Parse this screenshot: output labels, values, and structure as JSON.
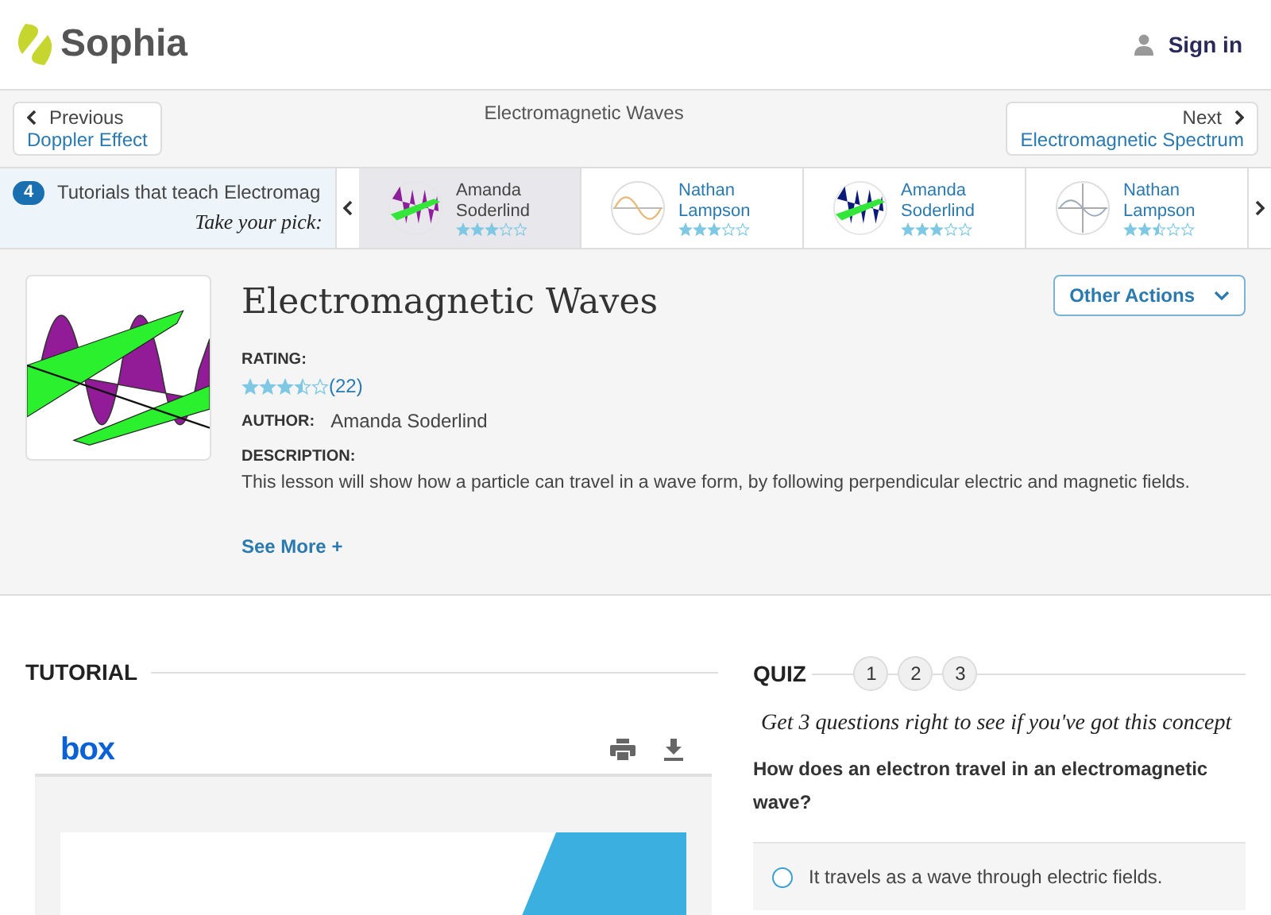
{
  "header": {
    "logo": "Sophia",
    "sign_in": "Sign in"
  },
  "nav": {
    "previous": {
      "label": "Previous",
      "title": "Doppler Effect"
    },
    "current": "Electromagnetic Waves",
    "next": {
      "label": "Next",
      "title": "Electromagnetic Spectrum"
    }
  },
  "tutorial_strip": {
    "count": "4",
    "intro": "Tutorials that teach Electromag",
    "tagline": "Take your pick:",
    "tutorials": [
      {
        "author": "Amanda Soderlind",
        "stars": 3,
        "kind": "wave",
        "color": "#8e1f9a",
        "selected": true
      },
      {
        "author": "Nathan Lampson",
        "stars": 3,
        "kind": "sine",
        "selected": false
      },
      {
        "author": "Amanda Soderlind",
        "stars": 3,
        "kind": "wave",
        "color": "#0a1a7a",
        "selected": false
      },
      {
        "author": "Nathan Lampson",
        "stars": 2.5,
        "kind": "axes",
        "selected": false
      }
    ]
  },
  "lesson": {
    "title": "Electromagnetic Waves",
    "other_actions": "Other Actions",
    "rating_label": "RATING:",
    "stars": 3.5,
    "rating_count": "(22)",
    "author_label": "AUTHOR:",
    "author": "Amanda Soderlind",
    "description_label": "DESCRIPTION:",
    "description": "This lesson will show how a particle can travel in a wave form, by following perpendicular electric and magnetic fields.",
    "see_more": "See More +"
  },
  "tutorial": {
    "heading": "TUTORIAL",
    "viewer_logo": "box"
  },
  "quiz": {
    "heading": "QUIZ",
    "steps": [
      "1",
      "2",
      "3"
    ],
    "tagline": "Get 3 questions right to see if you've got this concept",
    "question": "How does an electron travel in an electromagnetic wave?",
    "answers": [
      {
        "text": "It travels as a wave through electric fields.",
        "selected": false
      }
    ]
  }
}
